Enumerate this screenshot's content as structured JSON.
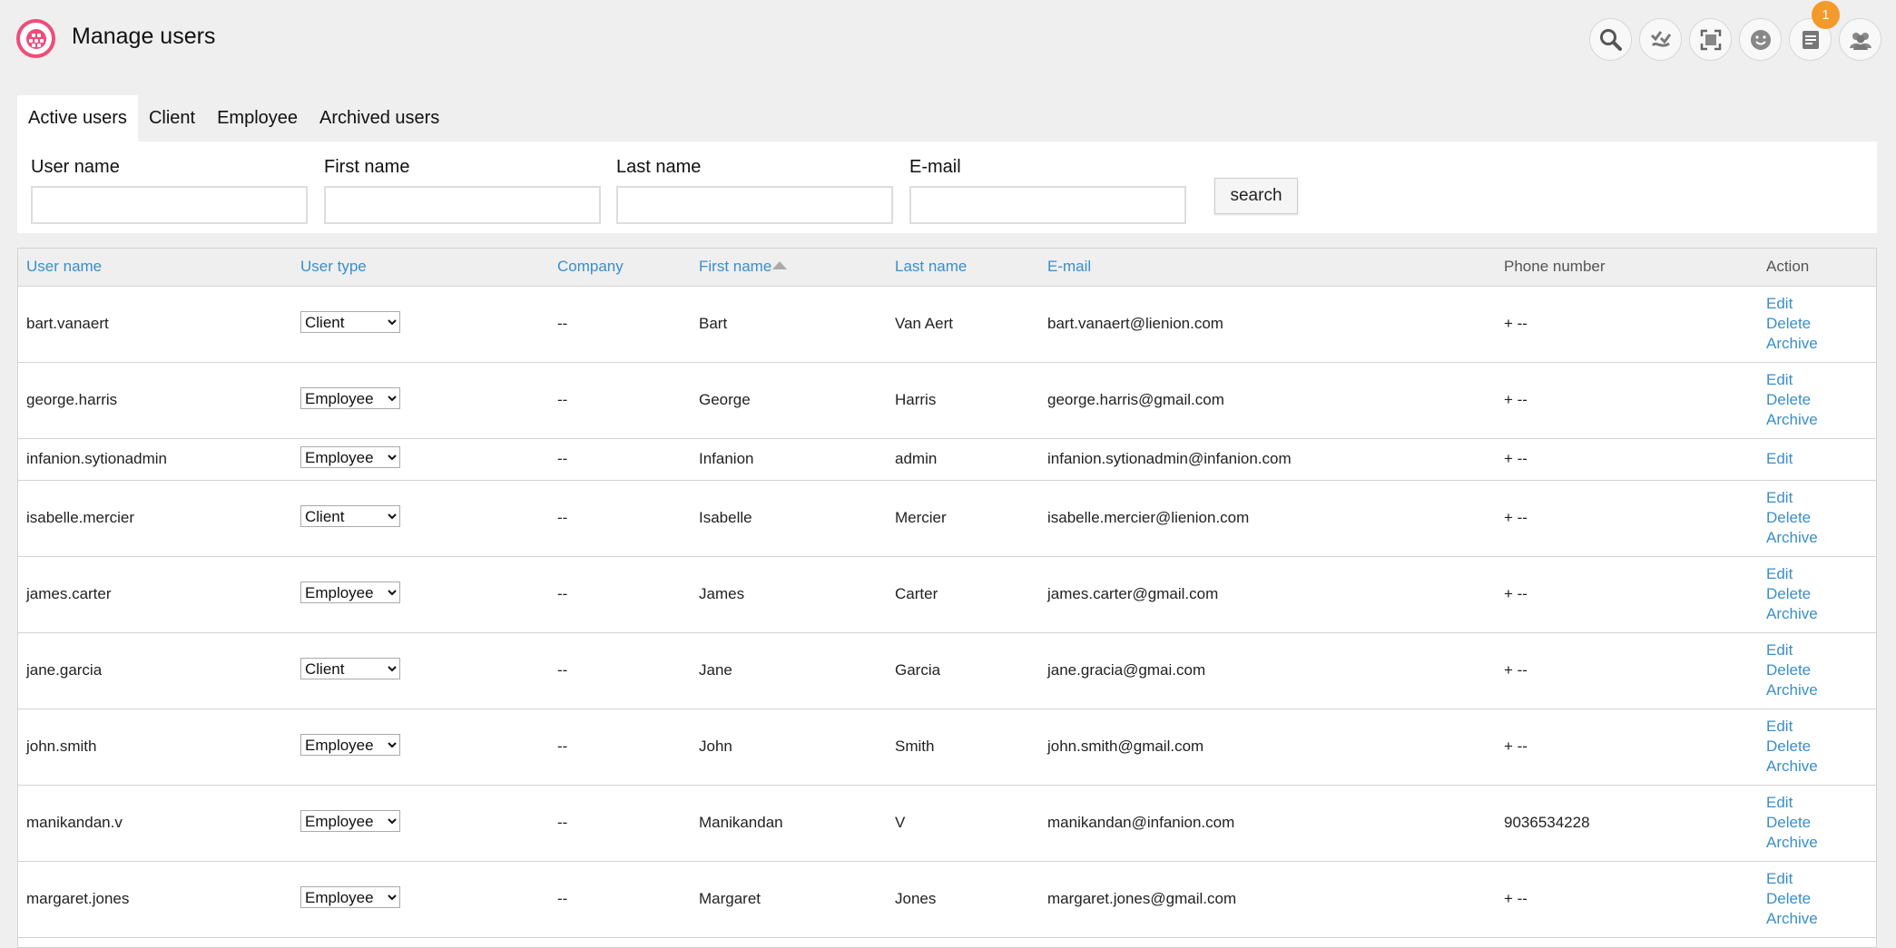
{
  "header": {
    "title": "Manage users",
    "notification_count": "1"
  },
  "top_icons": [
    "search-icon",
    "approval-icon",
    "fullscreen-icon",
    "smiley-icon",
    "notes-icon",
    "users-icon"
  ],
  "tabs": [
    "Active users",
    "Client",
    "Employee",
    "Archived users"
  ],
  "search": {
    "username_label": "User name",
    "firstname_label": "First name",
    "lastname_label": "Last name",
    "email_label": "E-mail",
    "button": "search"
  },
  "table": {
    "columns": [
      "User name",
      "User type",
      "Company",
      "First name",
      "Last name",
      "E-mail",
      "Phone number",
      "Action"
    ],
    "action_labels": {
      "edit": "Edit",
      "delete": "Delete",
      "archive": "Archive"
    },
    "rows": [
      {
        "username": "bart.vanaert",
        "type": "Client",
        "company": "--",
        "first": "Bart",
        "last": "Van Aert",
        "email": "bart.vanaert@lienion.com",
        "phone": "+ --",
        "actions": [
          "Edit",
          "Delete",
          "Archive"
        ]
      },
      {
        "username": "george.harris",
        "type": "Employee",
        "company": "--",
        "first": "George",
        "last": "Harris",
        "email": "george.harris@gmail.com",
        "phone": "+ --",
        "actions": [
          "Edit",
          "Delete",
          "Archive"
        ]
      },
      {
        "username": "infanion.sytionadmin",
        "type": "Employee",
        "company": "--",
        "first": "Infanion",
        "last": "admin",
        "email": "infanion.sytionadmin@infanion.com",
        "phone": "+ --",
        "actions": [
          "Edit"
        ]
      },
      {
        "username": "isabelle.mercier",
        "type": "Client",
        "company": "--",
        "first": "Isabelle",
        "last": "Mercier",
        "email": "isabelle.mercier@lienion.com",
        "phone": "+ --",
        "actions": [
          "Edit",
          "Delete",
          "Archive"
        ]
      },
      {
        "username": "james.carter",
        "type": "Employee",
        "company": "--",
        "first": "James",
        "last": "Carter",
        "email": "james.carter@gmail.com",
        "phone": "+ --",
        "actions": [
          "Edit",
          "Delete",
          "Archive"
        ]
      },
      {
        "username": "jane.garcia",
        "type": "Client",
        "company": "--",
        "first": "Jane",
        "last": "Garcia",
        "email": "jane.gracia@gmai.com",
        "phone": "+ --",
        "actions": [
          "Edit",
          "Delete",
          "Archive"
        ]
      },
      {
        "username": "john.smith",
        "type": "Employee",
        "company": "--",
        "first": "John",
        "last": "Smith",
        "email": "john.smith@gmail.com",
        "phone": "+ --",
        "actions": [
          "Edit",
          "Delete",
          "Archive"
        ]
      },
      {
        "username": "manikandan.v",
        "type": "Employee",
        "company": "--",
        "first": "Manikandan",
        "last": "V",
        "email": "manikandan@infanion.com",
        "phone": "9036534228",
        "actions": [
          "Edit",
          "Delete",
          "Archive"
        ]
      },
      {
        "username": "margaret.jones",
        "type": "Employee",
        "company": "--",
        "first": "Margaret",
        "last": "Jones",
        "email": "margaret.jones@gmail.com",
        "phone": "+ --",
        "actions": [
          "Edit",
          "Delete",
          "Archive"
        ]
      }
    ]
  },
  "colors": {
    "accent_link": "#3a8ec9",
    "logo": "#ee4d7a",
    "badge": "#f39a2b"
  }
}
